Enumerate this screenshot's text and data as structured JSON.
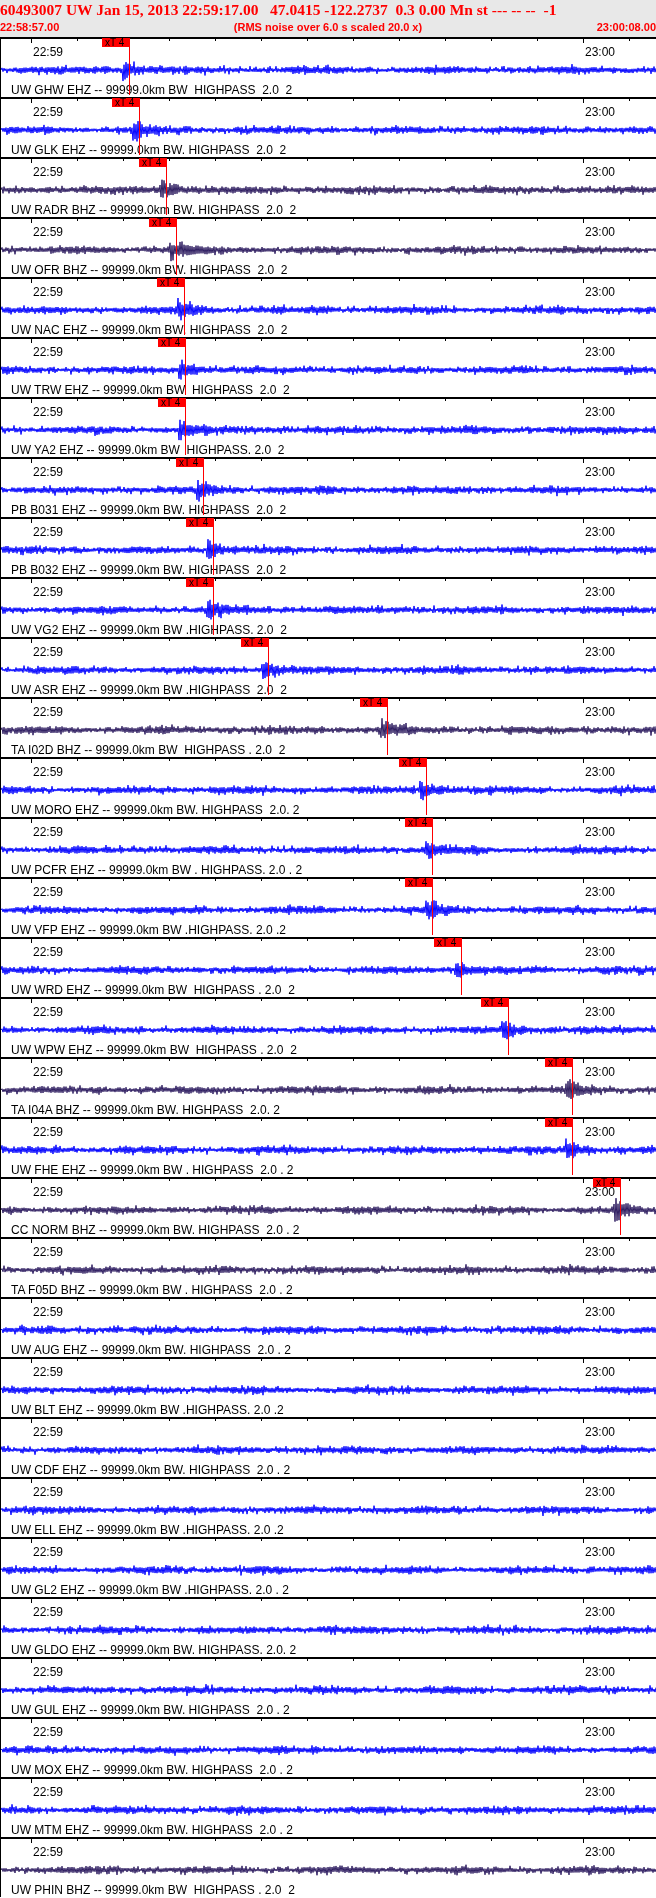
{
  "header": {
    "title": "60493007 UW Jan 15, 2013 22:59:17.00   47.0415 -122.2737  0.3 0.00 Mn st --- -- --  -1",
    "start_time": "22:58:57.00",
    "note": "(RMS noise over 6.0 s scaled 20.0 x)",
    "end_time": "23:00:08.00"
  },
  "traces": [
    {
      "label": "UW GHW EHZ -- 99999.0km BW  HIGHPASS  2.0  2",
      "color": "#0000ff",
      "start_tick": "22:59",
      "end_tick": "23:00",
      "pick": {
        "text": "xT 4"
      }
    },
    {
      "label": "UW GLK EHZ -- 99999.0km BW. HIGHPASS  2.0  2",
      "color": "#0000ff",
      "start_tick": "22:59",
      "end_tick": "23:00",
      "pick": {
        "text": "xT 4"
      }
    },
    {
      "label": "UW RADR BHZ -- 99999.0km BW. HIGHPASS  2.0  2",
      "color": "#2b1a5e",
      "start_tick": "22:59",
      "end_tick": "23:00",
      "pick": {
        "text": "xT 4"
      }
    },
    {
      "label": "UW OFR BHZ -- 99999.0km BW. HIGHPASS  2.0  2",
      "color": "#2b1a5e",
      "start_tick": "22:59",
      "end_tick": "23:00",
      "pick": {
        "text": "xT 4"
      }
    },
    {
      "label": "UW NAC EHZ -- 99999.0km BW. HIGHPASS  2.0  2",
      "color": "#0000ff",
      "start_tick": "22:59",
      "end_tick": "23:00",
      "pick": {
        "text": "xT 4"
      }
    },
    {
      "label": "UW TRW EHZ -- 99999.0km BW  HIGHPASS  2.0  2",
      "color": "#0000ff",
      "start_tick": "22:59",
      "end_tick": "23:00",
      "pick": {
        "text": "xT 4"
      }
    },
    {
      "label": "UW YA2 EHZ -- 99999.0km BW  HIGHPASS. 2.0  2",
      "color": "#0000ff",
      "start_tick": "22:59",
      "end_tick": "23:00",
      "pick": {
        "text": "xT 4"
      }
    },
    {
      "label": "PB B031 EHZ -- 99999.0km BW. HIGHPASS  2.0  2",
      "color": "#0000ff",
      "start_tick": "22:59",
      "end_tick": "23:00",
      "pick": {
        "text": "xT 4"
      }
    },
    {
      "label": "PB B032 EHZ -- 99999.0km BW. HIGHPASS  2.0  2",
      "color": "#0000ff",
      "start_tick": "22:59",
      "end_tick": "23:00",
      "pick": {
        "text": "xT 4"
      }
    },
    {
      "label": "UW VG2 EHZ -- 99999.0km BW .HIGHPASS. 2.0  2",
      "color": "#0000ff",
      "start_tick": "22:59",
      "end_tick": "23:00",
      "pick": {
        "text": "xT 4"
      }
    },
    {
      "label": "UW ASR EHZ -- 99999.0km BW .HIGHPASS  2.0  2",
      "color": "#0000ff",
      "start_tick": "22:59",
      "end_tick": "23:00",
      "pick": {
        "text": "xT 4"
      }
    },
    {
      "label": "TA I02D BHZ -- 99999.0km BW  HIGHPASS . 2.0  2",
      "color": "#2b1a5e",
      "start_tick": "22:59",
      "end_tick": "23:00",
      "pick": {
        "text": "xT 4"
      }
    },
    {
      "label": "UW MORO EHZ -- 99999.0km BW. HIGHPASS  2.0. 2",
      "color": "#0000ff",
      "start_tick": "22:59",
      "end_tick": "23:00",
      "pick": {
        "text": "xT 4"
      }
    },
    {
      "label": "UW PCFR EHZ -- 99999.0km BW . HIGHPASS. 2.0 . 2",
      "color": "#0000ff",
      "start_tick": "22:59",
      "end_tick": "23:00",
      "pick": {
        "text": "xT 4"
      }
    },
    {
      "label": "UW VFP EHZ -- 99999.0km BW .HIGHPASS. 2.0 .2",
      "color": "#0000ff",
      "start_tick": "22:59",
      "end_tick": "23:00",
      "pick": {
        "text": "xT 4"
      }
    },
    {
      "label": "UW WRD EHZ -- 99999.0km BW  HIGHPASS . 2.0  2",
      "color": "#0000ff",
      "start_tick": "22:59",
      "end_tick": "23:00",
      "pick": {
        "text": "xT 4"
      }
    },
    {
      "label": "UW WPW EHZ -- 99999.0km BW  HIGHPASS . 2.0  2",
      "color": "#0000ff",
      "start_tick": "22:59",
      "end_tick": "23:00",
      "pick": {
        "text": "xT 4"
      }
    },
    {
      "label": "TA I04A BHZ -- 99999.0km BW. HIGHPASS  2.0. 2",
      "color": "#2b1a5e",
      "start_tick": "22:59",
      "end_tick": "23:00",
      "pick": {
        "text": "xT 4"
      }
    },
    {
      "label": "UW FHE EHZ -- 99999.0km BW . HIGHPASS  2.0 . 2",
      "color": "#0000ff",
      "start_tick": "22:59",
      "end_tick": "23:00",
      "pick": {
        "text": "xT 4"
      }
    },
    {
      "label": "CC NORM BHZ -- 99999.0km BW. HIGHPASS  2.0 . 2",
      "color": "#2b1a5e",
      "start_tick": "22:59",
      "end_tick": "23:00",
      "pick": {
        "text": "xT 4"
      }
    },
    {
      "label": "TA F05D BHZ -- 99999.0km BW . HIGHPASS  2.0 . 2",
      "color": "#2b1a5e",
      "start_tick": "22:59",
      "end_tick": "23:00"
    },
    {
      "label": "UW AUG EHZ -- 99999.0km BW. HIGHPASS  2.0 . 2",
      "color": "#0000ff",
      "start_tick": "22:59",
      "end_tick": "23:00"
    },
    {
      "label": "UW BLT EHZ -- 99999.0km BW .HIGHPASS. 2.0 .2",
      "color": "#0000ff",
      "start_tick": "22:59",
      "end_tick": "23:00"
    },
    {
      "label": "UW CDF EHZ -- 99999.0km BW. HIGHPASS  2.0 . 2",
      "color": "#0000ff",
      "start_tick": "22:59",
      "end_tick": "23:00"
    },
    {
      "label": "UW ELL EHZ -- 99999.0km BW .HIGHPASS. 2.0 .2",
      "color": "#0000ff",
      "start_tick": "22:59",
      "end_tick": "23:00"
    },
    {
      "label": "UW GL2 EHZ -- 99999.0km BW .HIGHPASS. 2.0 . 2",
      "color": "#0000ff",
      "start_tick": "22:59",
      "end_tick": "23:00"
    },
    {
      "label": "UW GLDO EHZ -- 99999.0km BW. HIGHPASS. 2.0. 2",
      "color": "#0000ff",
      "start_tick": "22:59",
      "end_tick": "23:00"
    },
    {
      "label": "UW GUL EHZ -- 99999.0km BW. HIGHPASS  2.0 . 2",
      "color": "#0000ff",
      "start_tick": "22:59",
      "end_tick": "23:00"
    },
    {
      "label": "UW MOX EHZ -- 99999.0km BW. HIGHPASS  2.0 . 2",
      "color": "#0000ff",
      "start_tick": "22:59",
      "end_tick": "23:00"
    },
    {
      "label": "UW MTM EHZ -- 99999.0km BW. HIGHPASS  2.0 . 2",
      "color": "#0000ff",
      "start_tick": "22:59",
      "end_tick": "23:00"
    },
    {
      "label": "UW PHIN BHZ -- 99999.0km BW  HIGHPASS . 2.0  2",
      "color": "#2b1a5e",
      "start_tick": "22:59",
      "end_tick": "23:00"
    }
  ]
}
